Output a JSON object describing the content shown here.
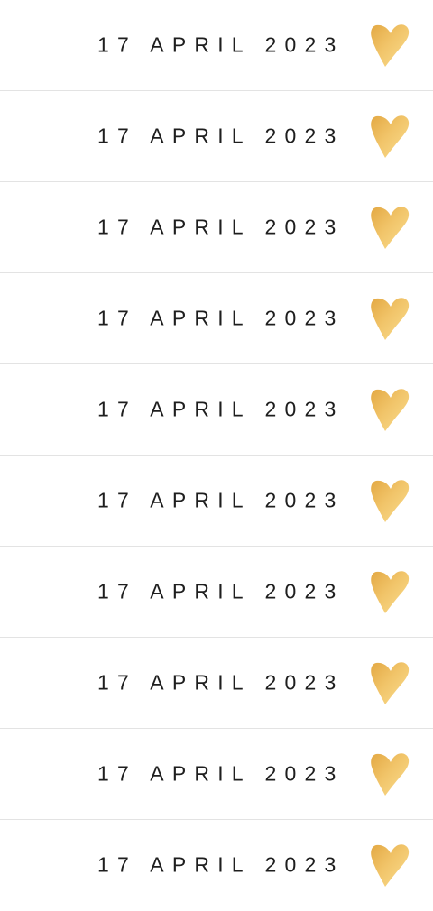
{
  "accent_color": "#e6b14e",
  "heart_icon": "gold-watercolor-heart-icon",
  "rows": [
    {
      "date": "17 APRIL 2023"
    },
    {
      "date": "17 APRIL 2023"
    },
    {
      "date": "17 APRIL 2023"
    },
    {
      "date": "17 APRIL 2023"
    },
    {
      "date": "17 APRIL 2023"
    },
    {
      "date": "17 APRIL 2023"
    },
    {
      "date": "17 APRIL 2023"
    },
    {
      "date": "17 APRIL 2023"
    },
    {
      "date": "17 APRIL 2023"
    },
    {
      "date": "17 APRIL 2023"
    }
  ]
}
